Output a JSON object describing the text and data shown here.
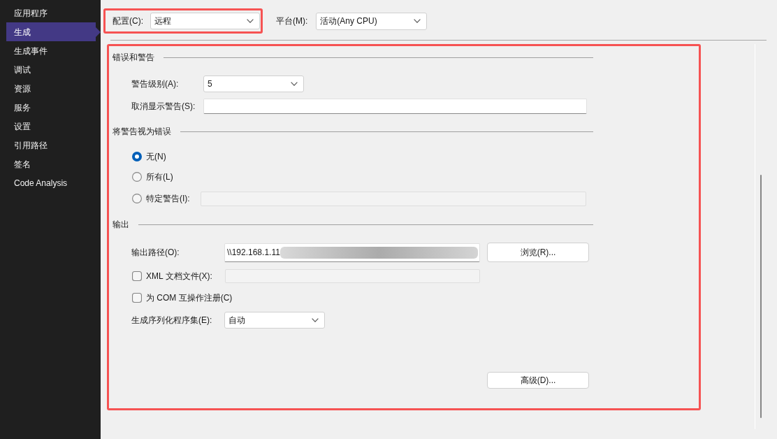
{
  "sidebar": {
    "items": [
      {
        "label": "应用程序",
        "selected": false
      },
      {
        "label": "生成",
        "selected": true
      },
      {
        "label": "生成事件",
        "selected": false
      },
      {
        "label": "调试",
        "selected": false
      },
      {
        "label": "资源",
        "selected": false
      },
      {
        "label": "服务",
        "selected": false
      },
      {
        "label": "设置",
        "selected": false
      },
      {
        "label": "引用路径",
        "selected": false
      },
      {
        "label": "签名",
        "selected": false
      },
      {
        "label": "Code Analysis",
        "selected": false
      }
    ]
  },
  "toolbar": {
    "configuration": {
      "label": "配置(C):",
      "value": "远程",
      "highlighted": true
    },
    "platform": {
      "label": "平台(M):",
      "value": "活动(Any CPU)"
    }
  },
  "panel": {
    "highlighted": true,
    "sections": [
      {
        "heading": "错误和警告",
        "rows": [
          {
            "kind": "dropdown",
            "label": "警告级别(A):",
            "value": "5"
          },
          {
            "kind": "text_field",
            "label": "取消显示警告(S):"
          }
        ]
      },
      {
        "heading": "将警告视为错误",
        "rows": [
          {
            "kind": "radio",
            "label": "无(N)",
            "selected": true
          },
          {
            "kind": "radio",
            "label": "所有(L)",
            "selected": false
          },
          {
            "kind": "radio",
            "label": "特定警告(I):",
            "selected": false,
            "field": {
              "disabled": true
            }
          }
        ]
      },
      {
        "heading": "输出",
        "rows": [
          {
            "kind": "path",
            "label": "输出路径(O):",
            "value": "\\\\192.168.1.11",
            "redacted": true,
            "button": "浏览(R)..."
          },
          {
            "kind": "checkbox",
            "label": "XML 文档文件(X):",
            "checked": false,
            "field": {
              "disabled": true
            }
          },
          {
            "kind": "checkbox",
            "label": "为 COM 互操作注册(C)",
            "checked": false
          },
          {
            "kind": "dropdown",
            "label": "生成序列化程序集(E):",
            "value": "自动"
          },
          {
            "kind": "button",
            "label": "高级(D)..."
          }
        ]
      }
    ]
  }
}
